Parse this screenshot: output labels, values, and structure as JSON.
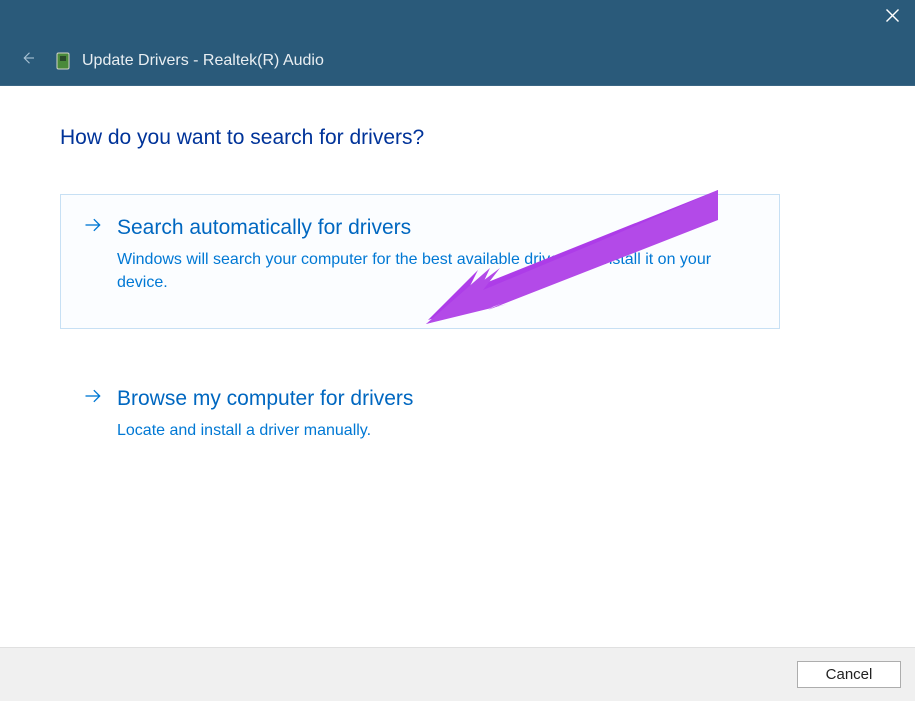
{
  "window": {
    "title": "Update Drivers - Realtek(R) Audio"
  },
  "heading": "How do you want to search for drivers?",
  "options": {
    "auto": {
      "title": "Search automatically for drivers",
      "desc": "Windows will search your computer for the best available driver and install it on your device."
    },
    "browse": {
      "title": "Browse my computer for drivers",
      "desc": "Locate and install a driver manually."
    }
  },
  "footer": {
    "cancel": "Cancel"
  }
}
